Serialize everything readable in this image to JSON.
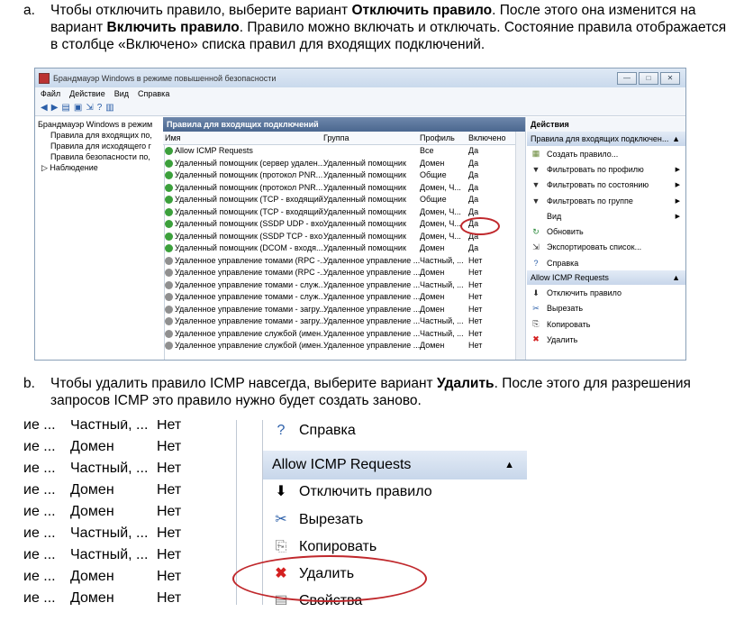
{
  "step_a": {
    "num": "a.",
    "text_1": "Чтобы отключить правило, выберите вариант ",
    "bold_1": "Отключить правило",
    "text_2": ". После этого она изменится на вариант ",
    "bold_2": "Включить правило",
    "text_3": ". Правило можно включать и отключать. Состояние правила отображается в столбце «Включено» списка правил для входящих подключений."
  },
  "step_b": {
    "num": "b.",
    "text_1": "Чтобы удалить правило ICMP навсегда, выберите вариант ",
    "bold_1": "Удалить",
    "text_2": ". После этого для разрешения запросов ICMP это правило нужно будет создать заново."
  },
  "window": {
    "title": "Брандмауэр Windows в режиме повышенной безопасности",
    "menu": [
      "Файл",
      "Действие",
      "Вид",
      "Справка"
    ],
    "tree": [
      "Брандмауэр Windows в режим",
      "Правила для входящих по,",
      "Правила для исходящего г",
      "Правила безопасности по,",
      "Наблюдение"
    ],
    "center_title": "Правила для входящих подключений",
    "columns": [
      "Имя",
      "Группа",
      "Профиль",
      "Включено"
    ],
    "rows": [
      {
        "name": "Allow ICMP Requests",
        "group": "",
        "profile": "Все",
        "enabled": "Да",
        "on": true
      },
      {
        "name": "Удаленный помощник (сервер удален...",
        "group": "Удаленный помощник",
        "profile": "Домен",
        "enabled": "Да",
        "on": true
      },
      {
        "name": "Удаленный помощник (протокол PNR...",
        "group": "Удаленный помощник",
        "profile": "Общие",
        "enabled": "Да",
        "on": true
      },
      {
        "name": "Удаленный помощник (протокол PNR...",
        "group": "Удаленный помощник",
        "profile": "Домен, Ч...",
        "enabled": "Да",
        "on": true
      },
      {
        "name": "Удаленный помощник (TCP - входящий)",
        "group": "Удаленный помощник",
        "profile": "Общие",
        "enabled": "Да",
        "on": true
      },
      {
        "name": "Удаленный помощник (TCP - входящий)",
        "group": "Удаленный помощник",
        "profile": "Домен, Ч...",
        "enabled": "Да",
        "on": true
      },
      {
        "name": "Удаленный помощник (SSDP UDP - вхо...",
        "group": "Удаленный помощник",
        "profile": "Домен, Ч...",
        "enabled": "Да",
        "on": true
      },
      {
        "name": "Удаленный помощник (SSDP TCP - вхо...",
        "group": "Удаленный помощник",
        "profile": "Домен, Ч...",
        "enabled": "Да",
        "on": true
      },
      {
        "name": "Удаленный помощник (DCOM - входя...",
        "group": "Удаленный помощник",
        "profile": "Домен",
        "enabled": "Да",
        "on": true
      },
      {
        "name": "Удаленное управление томами (RPC -...",
        "group": "Удаленное управление ...",
        "profile": "Частный, ...",
        "enabled": "Нет",
        "on": false
      },
      {
        "name": "Удаленное управление томами (RPC -...",
        "group": "Удаленное управление ...",
        "profile": "Домен",
        "enabled": "Нет",
        "on": false
      },
      {
        "name": "Удаленное управление томами - служ...",
        "group": "Удаленное управление ...",
        "profile": "Частный, ...",
        "enabled": "Нет",
        "on": false
      },
      {
        "name": "Удаленное управление томами - служ...",
        "group": "Удаленное управление ...",
        "profile": "Домен",
        "enabled": "Нет",
        "on": false
      },
      {
        "name": "Удаленное управление томами - загру...",
        "group": "Удаленное управление ...",
        "profile": "Домен",
        "enabled": "Нет",
        "on": false
      },
      {
        "name": "Удаленное управление томами - загру...",
        "group": "Удаленное управление ...",
        "profile": "Частный, ...",
        "enabled": "Нет",
        "on": false
      },
      {
        "name": "Удаленное управление службой (имен...",
        "group": "Удаленное управление ...",
        "profile": "Частный, ...",
        "enabled": "Нет",
        "on": false
      },
      {
        "name": "Удаленное управление службой (имен...",
        "group": "Удаленное управление ...",
        "profile": "Домен",
        "enabled": "Нет",
        "on": false
      }
    ],
    "actions_title": "Действия",
    "actions_section_1": "Правила для входящих подключен...",
    "actions_1": [
      {
        "label": "Создать правило...",
        "icon": "new-rule-icon",
        "arrow": false
      },
      {
        "label": "Фильтровать по профилю",
        "icon": "filter-icon",
        "arrow": true
      },
      {
        "label": "Фильтровать по состоянию",
        "icon": "filter-icon",
        "arrow": true
      },
      {
        "label": "Фильтровать по группе",
        "icon": "filter-icon",
        "arrow": true
      },
      {
        "label": "Вид",
        "icon": "",
        "arrow": true
      },
      {
        "label": "Обновить",
        "icon": "refresh-icon",
        "arrow": false
      },
      {
        "label": "Экспортировать список...",
        "icon": "export-icon",
        "arrow": false
      },
      {
        "label": "Справка",
        "icon": "help-icon",
        "arrow": false
      }
    ],
    "actions_section_2": "Allow ICMP Requests",
    "actions_2": [
      {
        "label": "Отключить правило",
        "icon": "disable-icon"
      },
      {
        "label": "Вырезать",
        "icon": "cut-icon"
      },
      {
        "label": "Копировать",
        "icon": "copy-icon"
      },
      {
        "label": "Удалить",
        "icon": "delete-icon"
      }
    ]
  },
  "zoom": {
    "rows": [
      {
        "a": "ие ...",
        "b": "Частный, ...",
        "c": "Нет"
      },
      {
        "a": "ие ...",
        "b": "Домен",
        "c": "Нет"
      },
      {
        "a": "ие ...",
        "b": "Частный, ...",
        "c": "Нет"
      },
      {
        "a": "ие ...",
        "b": "Домен",
        "c": "Нет"
      },
      {
        "a": "ие ...",
        "b": "Домен",
        "c": "Нет"
      },
      {
        "a": "ие ...",
        "b": "Частный, ...",
        "c": "Нет"
      },
      {
        "a": "ие ...",
        "b": "Частный, ...",
        "c": "Нет"
      },
      {
        "a": "ие ...",
        "b": "Домен",
        "c": "Нет"
      },
      {
        "a": "ие ...",
        "b": "Домен",
        "c": "Нет"
      }
    ],
    "help": "Справка",
    "section": "Allow ICMP Requests",
    "actions": [
      "Отключить правило",
      "Вырезать",
      "Копировать",
      "Удалить",
      "Свойства"
    ],
    "accent_red": "#c0282c"
  }
}
